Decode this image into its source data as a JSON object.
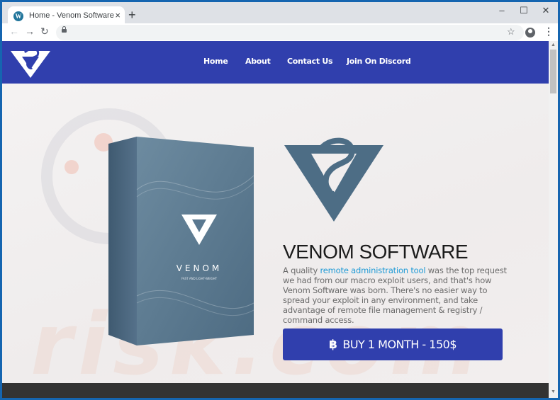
{
  "browser": {
    "tab_title": "Home - Venom Software",
    "tab_close": "×",
    "new_tab": "+",
    "minimize": "–",
    "maximize": "☐",
    "close": "✕",
    "back": "←",
    "forward": "→",
    "reload": "↻",
    "bookmark_star": "☆",
    "menu": "⋮"
  },
  "site": {
    "nav": [
      "Home",
      "About",
      "Contact Us",
      "Join On Discord"
    ],
    "box_brand": "VENOM",
    "box_tagline": "FAST AND LIGHT-WEIGHT",
    "heading": "VENOM SOFTWARE",
    "desc_before": "A quality ",
    "desc_link": "remote administration tool",
    "desc_after": " was the top request we had from our macro exploit users, and that's how Venom Software was born. There's no easier way to spread your exploit in any environment, and take advantage of remote file management & registry / command access.",
    "buy_icon": "฿",
    "buy_label": "BUY 1 MONTH - 150$",
    "watermark": "risk.com"
  },
  "colors": {
    "brand": "#303fad",
    "link": "#1e9ad6",
    "logo_slate": "#4d6d85"
  }
}
